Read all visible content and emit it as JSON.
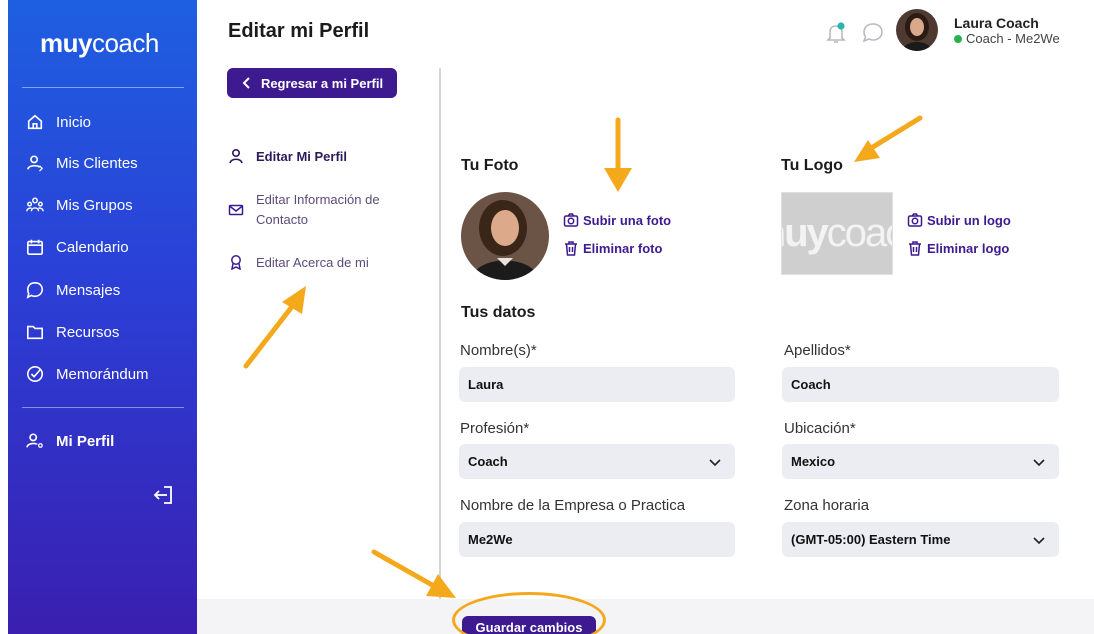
{
  "brand": {
    "logo_bold": "muy",
    "logo_light": "coach"
  },
  "sidebar": {
    "items": [
      {
        "label": "Inicio",
        "icon": "home-icon"
      },
      {
        "label": "Mis Clientes",
        "icon": "user-icon"
      },
      {
        "label": "Mis Grupos",
        "icon": "group-icon"
      },
      {
        "label": "Calendario",
        "icon": "calendar-icon"
      },
      {
        "label": "Mensajes",
        "icon": "chat-icon"
      },
      {
        "label": "Recursos",
        "icon": "folder-icon"
      },
      {
        "label": "Memorándum",
        "icon": "check-circle-icon"
      }
    ],
    "profile_label": "Mi Perfil",
    "logout_icon": "logout-icon"
  },
  "header": {
    "title": "Editar mi Perfil",
    "user_name": "Laura Coach",
    "user_role": "Coach - Me2We",
    "status_color": "#27b34b"
  },
  "back_button": "Regresar a mi Perfil",
  "subnav": {
    "edit_profile": "Editar Mi Perfil",
    "edit_contact": "Editar Información de Contacto",
    "edit_about": "Editar Acerca de mi"
  },
  "photo_section": {
    "title": "Tu Foto",
    "upload": "Subir una foto",
    "delete": "Eliminar foto"
  },
  "logo_section": {
    "title": "Tu Logo",
    "upload": "Subir un logo",
    "delete": "Eliminar logo"
  },
  "data_section": {
    "title": "Tus datos",
    "first_name_label": "Nombre(s)*",
    "first_name_value": "Laura",
    "last_name_label": "Apellidos*",
    "last_name_value": "Coach",
    "profession_label": "Profesión*",
    "profession_value": "Coach",
    "location_label": "Ubicación*",
    "location_value": "Mexico",
    "company_label": "Nombre de la Empresa o Practica",
    "company_value": "Me2We",
    "timezone_label": "Zona horaria",
    "timezone_value": "(GMT-05:00) Eastern Time"
  },
  "save_button": "Guardar cambios",
  "colors": {
    "accent": "#3d1a8f",
    "annotation": "#f4a91c",
    "sidebar_top": "#1e5fe0",
    "sidebar_bottom": "#3a1fb0"
  }
}
